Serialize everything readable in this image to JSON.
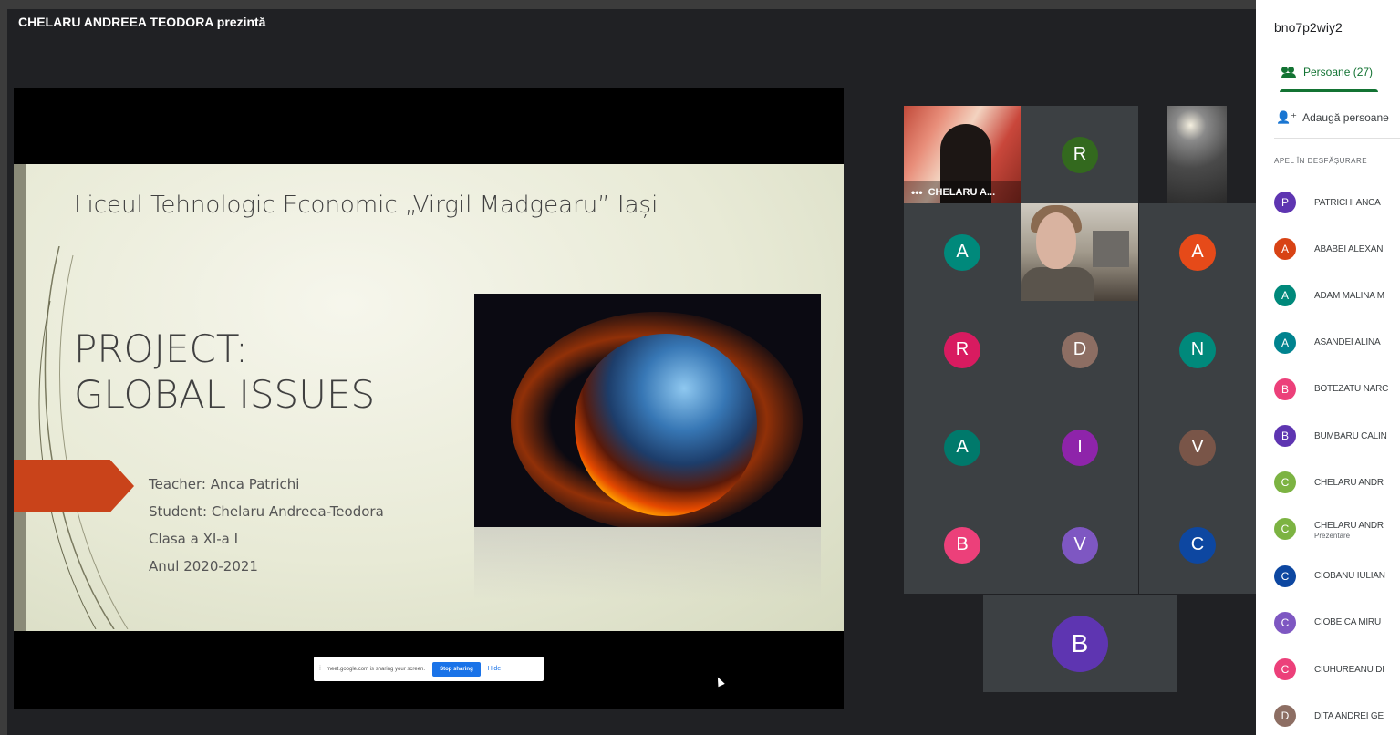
{
  "presenter_banner": "CHELARU ANDREEA TEODORA prezintă",
  "slide": {
    "school": "Liceul Tehnologic Economic „Virgil Madgearu” Iași",
    "title_line1": "PROJECT:",
    "title_line2": "GLOBAL ISSUES",
    "teacher": "Teacher: Anca Patrichi",
    "student": "Student: Chelaru Andreea-Teodora",
    "class": "Clasa a XI-a I",
    "year": "Anul 2020-2021"
  },
  "share_bar": {
    "message": "meet.google.com is sharing your screen.",
    "stop_label": "Stop sharing",
    "hide_label": "Hide"
  },
  "tiles": {
    "presenter_name": "CHELARU A...",
    "avatars": [
      {
        "letter": "R",
        "color": "#33691e"
      },
      {
        "letter": "A",
        "color": "#00897b"
      },
      {
        "letter": "A",
        "color": "#e64a19"
      },
      {
        "letter": "R",
        "color": "#d81b60"
      },
      {
        "letter": "D",
        "color": "#8d6e63"
      },
      {
        "letter": "N",
        "color": "#00897b"
      },
      {
        "letter": "A",
        "color": "#00796b"
      },
      {
        "letter": "I",
        "color": "#8e24aa"
      },
      {
        "letter": "V",
        "color": "#795548"
      },
      {
        "letter": "B",
        "color": "#ec407a"
      },
      {
        "letter": "V",
        "color": "#7e57c2"
      },
      {
        "letter": "C",
        "color": "#0d47a1"
      }
    ],
    "bottom_avatar": {
      "letter": "B",
      "color": "#5e35b1"
    }
  },
  "panel": {
    "meeting_code": "bno7p2wiy2",
    "people_tab": "Persoane (27)",
    "add_people": "Adaugă persoane",
    "section_label": "APEL ÎN DESFĂȘURARE",
    "participants": [
      {
        "letter": "P",
        "color": "#5e35b1",
        "name": "PATRICHI ANCA"
      },
      {
        "letter": "A",
        "color": "#d84315",
        "name": "ABABEI ALEXAN"
      },
      {
        "letter": "A",
        "color": "#00897b",
        "name": "ADAM MALINA M"
      },
      {
        "letter": "A",
        "color": "#00838f",
        "name": "ASANDEI ALINA"
      },
      {
        "letter": "B",
        "color": "#ec407a",
        "name": "BOTEZATU NARC"
      },
      {
        "letter": "B",
        "color": "#5e35b1",
        "name": "BUMBARU CALIN"
      },
      {
        "letter": "C",
        "color": "#7cb342",
        "name": "CHELARU ANDR"
      },
      {
        "letter": "C",
        "color": "#7cb342",
        "name": "CHELARU ANDR",
        "sub": "Prezentare"
      },
      {
        "letter": "C",
        "color": "#0d47a1",
        "name": "CIOBANU IULIAN"
      },
      {
        "letter": "C",
        "color": "#7e57c2",
        "name": "CIOBEICA MIRU"
      },
      {
        "letter": "C",
        "color": "#ec407a",
        "name": "CIUHUREANU DI"
      },
      {
        "letter": "D",
        "color": "#8d6e63",
        "name": "DITA ANDREI GE"
      }
    ]
  }
}
